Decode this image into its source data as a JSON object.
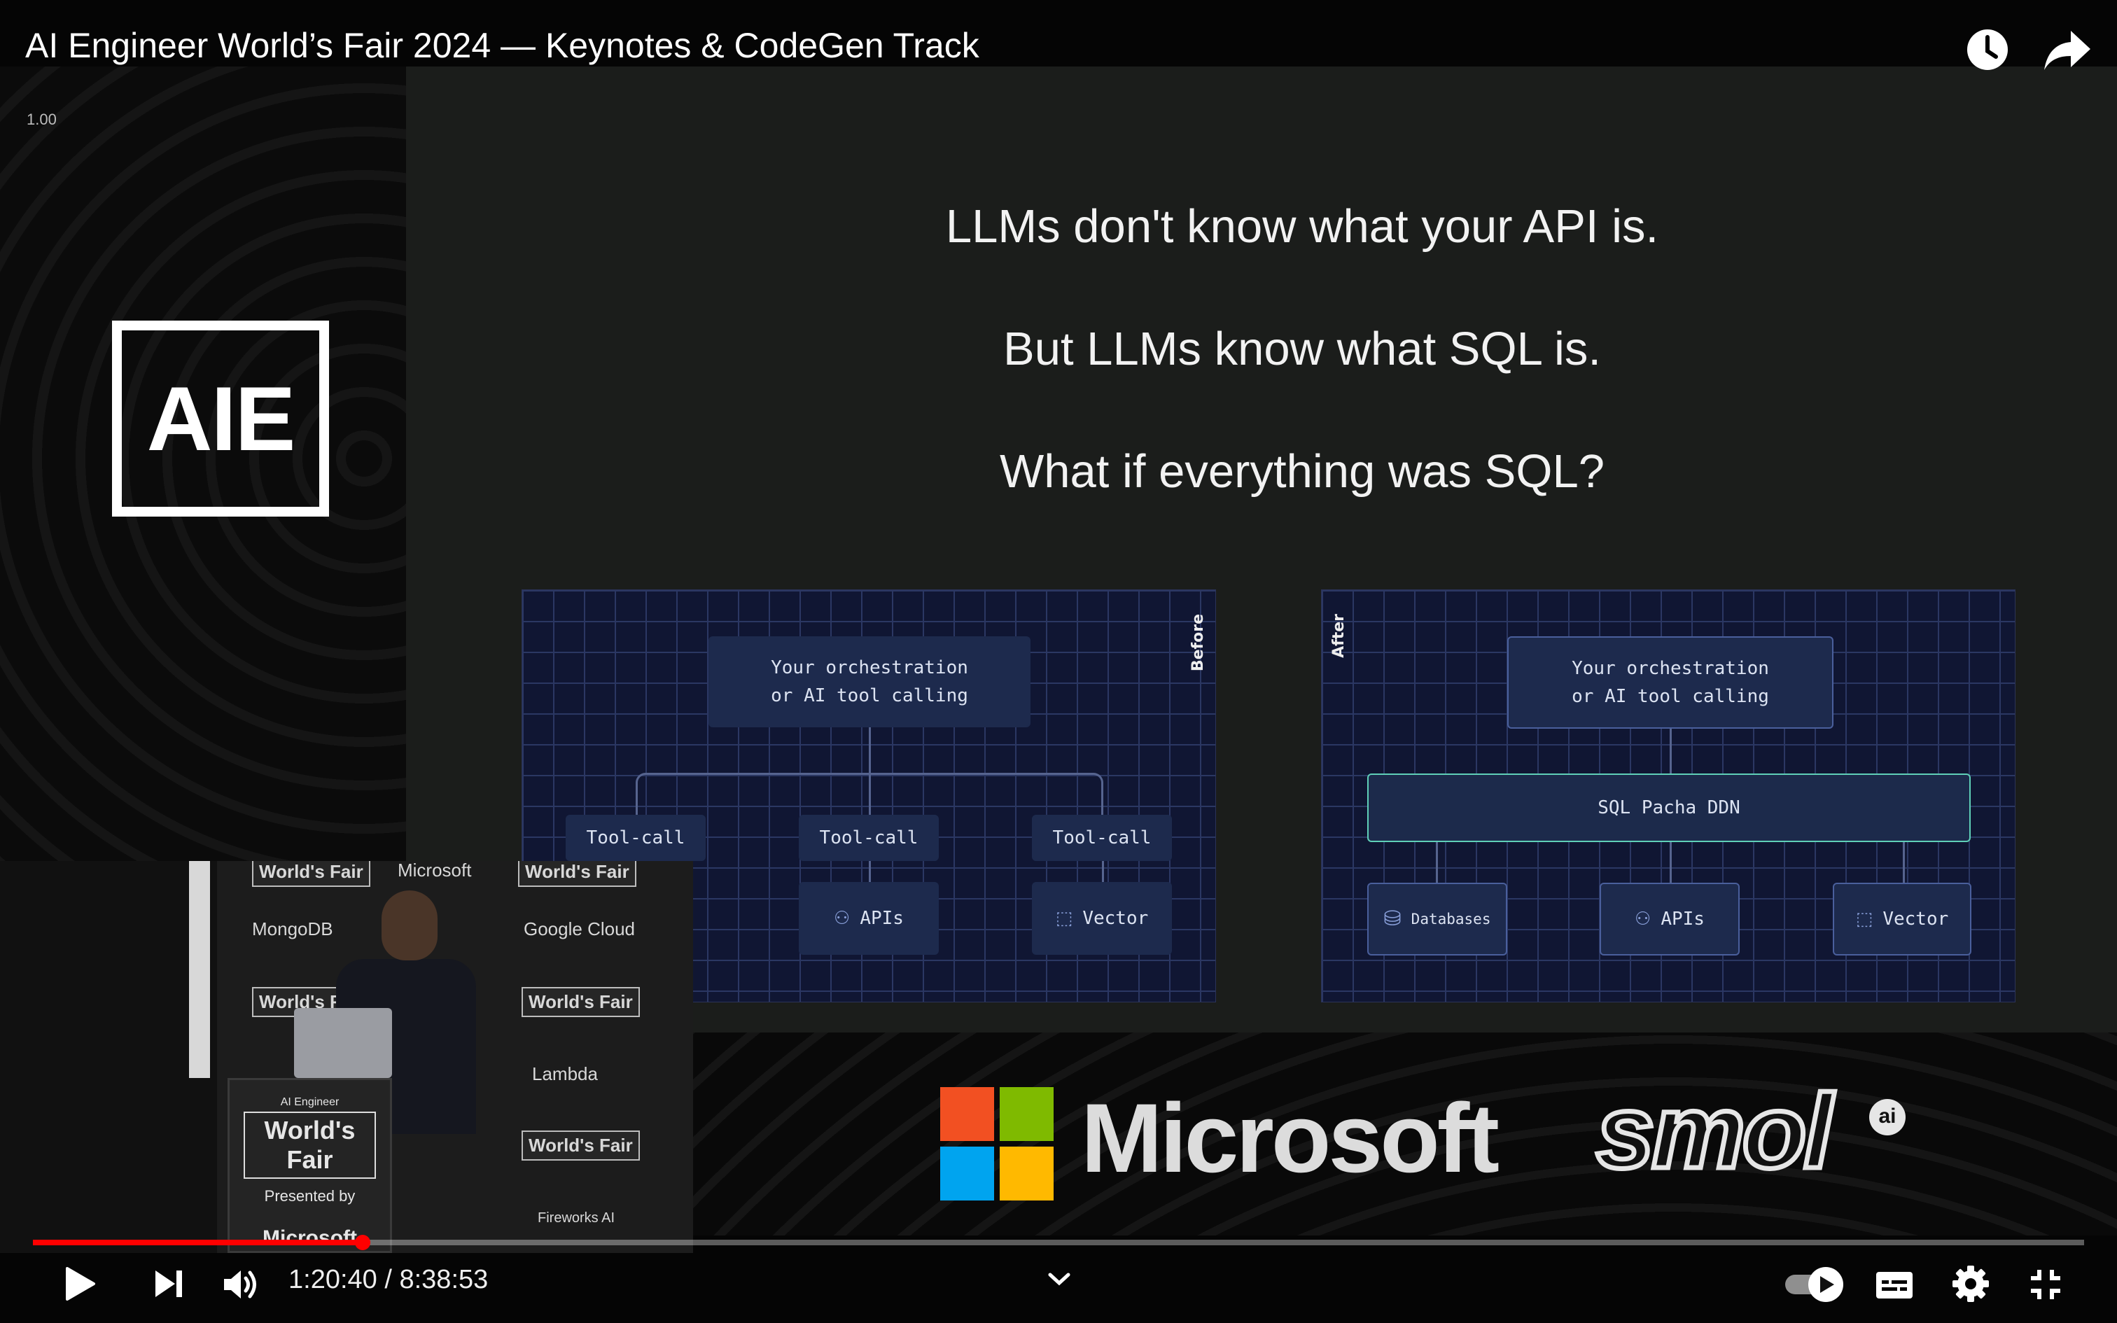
{
  "video": {
    "title": "AI Engineer World’s Fair 2024 — Keynotes & CodeGen Track",
    "speed_readout": "1.00",
    "aie_logo_text": "AIE",
    "slide": {
      "lines": [
        "LLMs don't know what your API is.",
        "But LLMs know what SQL is.",
        "What if everything was SQL?"
      ],
      "before": {
        "label": "Before",
        "orchestration_line1": "Your orchestration",
        "orchestration_line2": "or AI tool calling",
        "tool_call_labels": [
          "Tool-call",
          "Tool-call",
          "Tool-call"
        ],
        "apis_label": "APIs",
        "vector_label": "Vector"
      },
      "after": {
        "label": "After",
        "orchestration_line1": "Your orchestration",
        "orchestration_line2": "or AI tool calling",
        "ddn_label": "SQL Pacha DDN",
        "databases_label": "Databases",
        "apis_label": "APIs",
        "vector_label": "Vector"
      }
    },
    "sponsor_bar": {
      "microsoft_text": "Microsoft",
      "smol_text": "smol",
      "smol_ai_badge": "ai",
      "microsoft_colors": [
        "#f25022",
        "#7fba00",
        "#00a4ef",
        "#ffb900"
      ]
    },
    "speaker_cam": {
      "sponsors": [
        "World's Fair",
        "Microsoft",
        "MongoDB",
        "World's Fair",
        "Google Cloud",
        "World's Fair",
        "World's Fair",
        "Lambda",
        "World's Fair",
        "Fireworks AI"
      ],
      "podium_top": "AI Engineer",
      "podium_title": "World's Fair",
      "podium_presented": "Presented by",
      "podium_sponsor": "Microsoft"
    }
  },
  "player": {
    "progress_fraction": 0.1607,
    "current_time": "1:20:40",
    "duration": "8:38:53",
    "time_separator": " / ",
    "accent_color": "#ff0000",
    "icons": {
      "play": "play-icon",
      "next": "next-icon",
      "volume": "volume-icon",
      "chevron": "chevron-down-icon",
      "autoplay": "autoplay-toggle-icon",
      "captions": "captions-icon",
      "settings": "settings-gear-icon",
      "exit_fullscreen": "exit-fullscreen-icon",
      "watch_later": "clock-icon",
      "share": "share-icon"
    }
  }
}
